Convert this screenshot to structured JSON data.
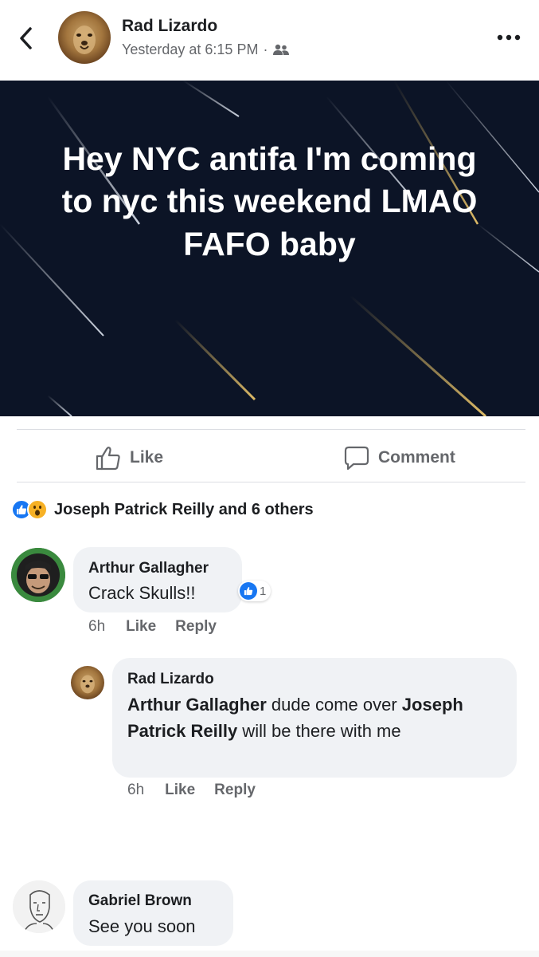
{
  "header": {
    "author": "Rad Lizardo",
    "time": "Yesterday at 6:15 PM",
    "separator": "·",
    "back_icon": "chevron-left-icon",
    "more_icon": "more-dots-icon",
    "audience_icon": "friends-icon"
  },
  "post": {
    "text": "Hey NYC antifa I'm coming to nyc this weekend LMAO FAFO baby",
    "background_color": "#0c1426"
  },
  "actions": {
    "like_label": "Like",
    "comment_label": "Comment"
  },
  "reactions": {
    "summary": "Joseph Patrick Reilly and 6 others",
    "types": [
      "like",
      "wow"
    ]
  },
  "comments": [
    {
      "author": "Arthur Gallagher",
      "text": "Crack Skulls!!",
      "like_count": "1",
      "time": "6h",
      "like_label": "Like",
      "reply_label": "Reply"
    },
    {
      "author": "Rad Lizardo",
      "mention1": "Arthur Gallagher",
      "text1": " dude come over ",
      "mention2": "Joseph Patrick Reilly",
      "text2": " will be there with me",
      "time": "6h",
      "like_label": "Like",
      "reply_label": "Reply"
    },
    {
      "author": "Gabriel Brown",
      "text": "See you soon"
    }
  ],
  "colors": {
    "accent": "#1877f2",
    "secondary_text": "#65676b",
    "bubble": "#f0f2f5"
  }
}
